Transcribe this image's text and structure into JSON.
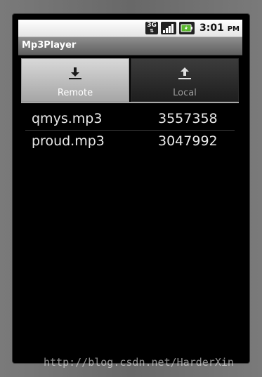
{
  "status_bar": {
    "network": "3G",
    "time": "3:01",
    "ampm": "PM"
  },
  "app": {
    "title": "Mp3Player"
  },
  "tabs": [
    {
      "label": "Remote",
      "icon": "download-icon",
      "selected": true
    },
    {
      "label": "Local",
      "icon": "upload-icon",
      "selected": false
    }
  ],
  "files": [
    {
      "name": "qmys.mp3",
      "size": "3557358"
    },
    {
      "name": "proud.mp3",
      "size": "3047992"
    }
  ],
  "watermark": "http://blog.csdn.net/HarderXin",
  "colors": {
    "status_bar_bg": "#f0f0f0",
    "title_bar_bg": "#6f6f6f",
    "screen_bg": "#000000",
    "text_primary": "#e8e8e8",
    "battery_accent": "#5bb82f"
  }
}
